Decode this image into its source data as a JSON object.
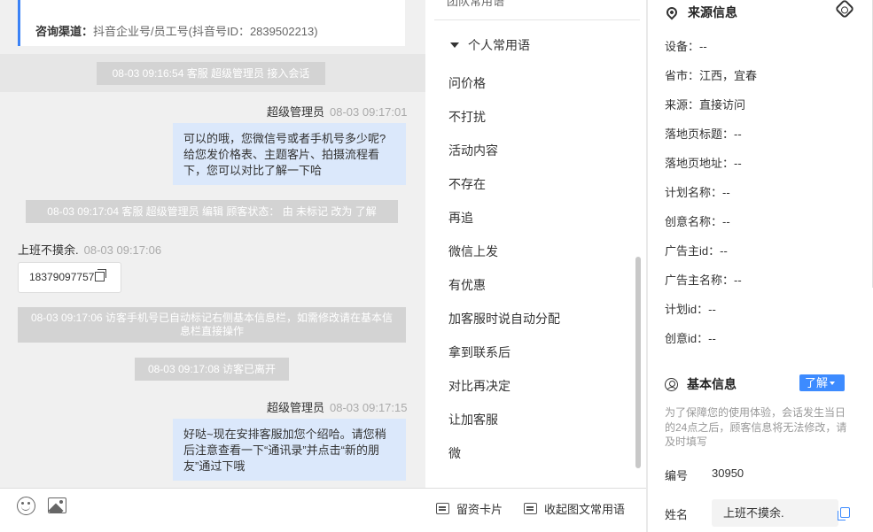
{
  "chat": {
    "channel_label": "咨询渠道：",
    "channel_value": "抖音企业号/员工号(抖音号ID：2839502213)",
    "events": {
      "join": "08-03 09:16:54 客服 超级管理员 接入会话",
      "status_edit": "08-03 09:17:04 客服 超级管理员 编辑 顾客状态： 由 未标记 改为 了解",
      "auto_mark": "08-03 09:17:06 访客手机号已自动标记右侧基本信息栏，如需修改请在基本信息栏直接操作",
      "left": "08-03 09:17:08 访客已离开"
    },
    "messages": [
      {
        "sender": "超级管理员",
        "time": "08-03 09:17:01",
        "text": "可以的哦，您微信号或者手机号多少呢?给您发价格表、主题客片、拍摄流程看下，您可以对比了解一下哈"
      },
      {
        "sender": "上班不摸余.",
        "time": "08-03 09:17:06",
        "text": "18379097757"
      },
      {
        "sender": "超级管理员",
        "time": "08-03 09:17:15",
        "text": "好哒~现在安排客服加您个绍哈。请您稍后注意查看一下“通讯录”并点击“新的朋友”通过下哦"
      }
    ]
  },
  "toolbar": {
    "emoji_icon": "smile-icon",
    "image_icon": "image-icon",
    "leave_card_label": "留资卡片",
    "collapse_label": "收起图文常用语"
  },
  "phrases": {
    "top_cut_label": "团队常用语",
    "group_title": "个人常用语",
    "items": [
      "问价格",
      "不打扰",
      "活动内容",
      "不存在",
      "再追",
      "微信上发",
      "有优惠",
      "加客服时说自动分配",
      "拿到联系后",
      "对比再决定",
      "让加客服",
      "微"
    ]
  },
  "source_info": {
    "title": "来源信息",
    "fields": [
      "设备：--",
      "省市：江西，宜春",
      "来源：直接访问",
      "落地页标题：--",
      "落地页地址：--",
      "计划名称：--",
      "创意名称：--",
      "广告主id：--",
      "广告主名称：--",
      "计划id：--",
      "创意id：--"
    ]
  },
  "basic_info": {
    "title": "基本信息",
    "status_button": "了解",
    "notice": "为了保障您的使用体验，会话发生当日的24点之后，顾客信息将无法修改，请及时填写",
    "id_label": "编号",
    "id_value": "30950",
    "name_label": "姓名",
    "name_value": "上班不摸余."
  },
  "colors": {
    "accent": "#3d8bff",
    "outgoing_bubble": "#dbe8fb",
    "system_pill": "#d3d3d3",
    "chat_background": "#f0f0f0"
  }
}
